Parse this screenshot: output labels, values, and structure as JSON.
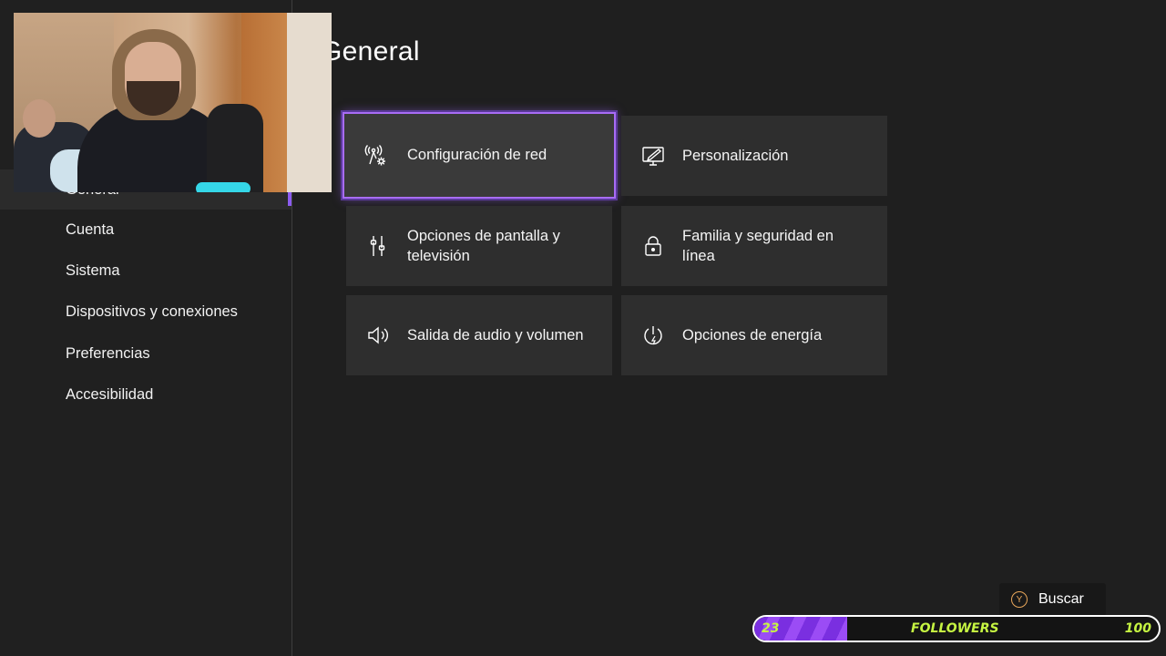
{
  "page": {
    "title": "General"
  },
  "sidebar": {
    "items": [
      {
        "label": "General",
        "selected": true
      },
      {
        "label": "Cuenta"
      },
      {
        "label": "Sistema"
      },
      {
        "label": "Dispositivos y conexiones"
      },
      {
        "label": "Preferencias"
      },
      {
        "label": "Accesibilidad"
      }
    ]
  },
  "tiles": [
    {
      "label": "Configuración de red",
      "icon": "network-settings-icon",
      "focused": true
    },
    {
      "label": "Personalización",
      "icon": "personalization-icon"
    },
    {
      "label": "Opciones de pantalla y televisión",
      "icon": "display-tv-icon"
    },
    {
      "label": "Familia y seguridad en línea",
      "icon": "lock-icon"
    },
    {
      "label": "Salida de audio y volumen",
      "icon": "speaker-icon"
    },
    {
      "label": "Opciones de energía",
      "icon": "power-icon"
    }
  ],
  "buscar": {
    "button": "Y",
    "label": "Buscar"
  },
  "followers": {
    "current": "23",
    "label": "FOLLOWERS",
    "goal": "100",
    "progress_fraction": 0.23
  },
  "colors": {
    "accent": "#a86cf6",
    "progress_text": "#c6f542",
    "y_button": "#e7a65a"
  }
}
